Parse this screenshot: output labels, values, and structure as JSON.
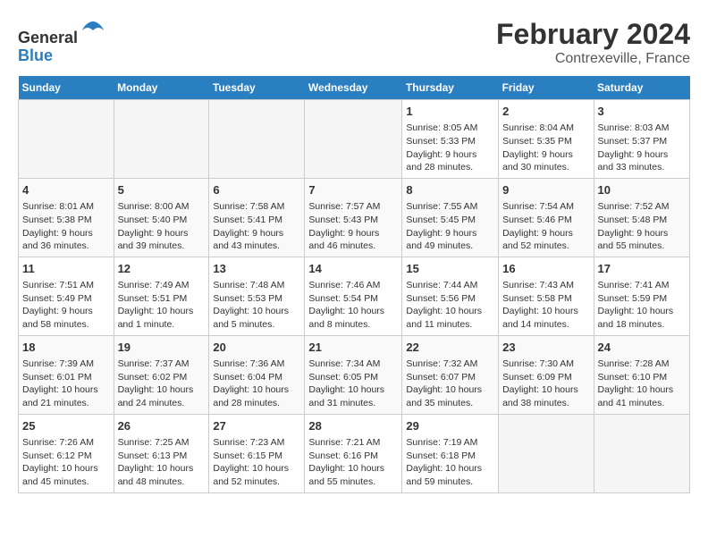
{
  "header": {
    "logo_line1": "General",
    "logo_line2": "Blue",
    "main_title": "February 2024",
    "subtitle": "Contrexeville, France"
  },
  "columns": [
    "Sunday",
    "Monday",
    "Tuesday",
    "Wednesday",
    "Thursday",
    "Friday",
    "Saturday"
  ],
  "weeks": [
    [
      {
        "day": "",
        "info": ""
      },
      {
        "day": "",
        "info": ""
      },
      {
        "day": "",
        "info": ""
      },
      {
        "day": "",
        "info": ""
      },
      {
        "day": "1",
        "info": "Sunrise: 8:05 AM\nSunset: 5:33 PM\nDaylight: 9 hours\nand 28 minutes."
      },
      {
        "day": "2",
        "info": "Sunrise: 8:04 AM\nSunset: 5:35 PM\nDaylight: 9 hours\nand 30 minutes."
      },
      {
        "day": "3",
        "info": "Sunrise: 8:03 AM\nSunset: 5:37 PM\nDaylight: 9 hours\nand 33 minutes."
      }
    ],
    [
      {
        "day": "4",
        "info": "Sunrise: 8:01 AM\nSunset: 5:38 PM\nDaylight: 9 hours\nand 36 minutes."
      },
      {
        "day": "5",
        "info": "Sunrise: 8:00 AM\nSunset: 5:40 PM\nDaylight: 9 hours\nand 39 minutes."
      },
      {
        "day": "6",
        "info": "Sunrise: 7:58 AM\nSunset: 5:41 PM\nDaylight: 9 hours\nand 43 minutes."
      },
      {
        "day": "7",
        "info": "Sunrise: 7:57 AM\nSunset: 5:43 PM\nDaylight: 9 hours\nand 46 minutes."
      },
      {
        "day": "8",
        "info": "Sunrise: 7:55 AM\nSunset: 5:45 PM\nDaylight: 9 hours\nand 49 minutes."
      },
      {
        "day": "9",
        "info": "Sunrise: 7:54 AM\nSunset: 5:46 PM\nDaylight: 9 hours\nand 52 minutes."
      },
      {
        "day": "10",
        "info": "Sunrise: 7:52 AM\nSunset: 5:48 PM\nDaylight: 9 hours\nand 55 minutes."
      }
    ],
    [
      {
        "day": "11",
        "info": "Sunrise: 7:51 AM\nSunset: 5:49 PM\nDaylight: 9 hours\nand 58 minutes."
      },
      {
        "day": "12",
        "info": "Sunrise: 7:49 AM\nSunset: 5:51 PM\nDaylight: 10 hours\nand 1 minute."
      },
      {
        "day": "13",
        "info": "Sunrise: 7:48 AM\nSunset: 5:53 PM\nDaylight: 10 hours\nand 5 minutes."
      },
      {
        "day": "14",
        "info": "Sunrise: 7:46 AM\nSunset: 5:54 PM\nDaylight: 10 hours\nand 8 minutes."
      },
      {
        "day": "15",
        "info": "Sunrise: 7:44 AM\nSunset: 5:56 PM\nDaylight: 10 hours\nand 11 minutes."
      },
      {
        "day": "16",
        "info": "Sunrise: 7:43 AM\nSunset: 5:58 PM\nDaylight: 10 hours\nand 14 minutes."
      },
      {
        "day": "17",
        "info": "Sunrise: 7:41 AM\nSunset: 5:59 PM\nDaylight: 10 hours\nand 18 minutes."
      }
    ],
    [
      {
        "day": "18",
        "info": "Sunrise: 7:39 AM\nSunset: 6:01 PM\nDaylight: 10 hours\nand 21 minutes."
      },
      {
        "day": "19",
        "info": "Sunrise: 7:37 AM\nSunset: 6:02 PM\nDaylight: 10 hours\nand 24 minutes."
      },
      {
        "day": "20",
        "info": "Sunrise: 7:36 AM\nSunset: 6:04 PM\nDaylight: 10 hours\nand 28 minutes."
      },
      {
        "day": "21",
        "info": "Sunrise: 7:34 AM\nSunset: 6:05 PM\nDaylight: 10 hours\nand 31 minutes."
      },
      {
        "day": "22",
        "info": "Sunrise: 7:32 AM\nSunset: 6:07 PM\nDaylight: 10 hours\nand 35 minutes."
      },
      {
        "day": "23",
        "info": "Sunrise: 7:30 AM\nSunset: 6:09 PM\nDaylight: 10 hours\nand 38 minutes."
      },
      {
        "day": "24",
        "info": "Sunrise: 7:28 AM\nSunset: 6:10 PM\nDaylight: 10 hours\nand 41 minutes."
      }
    ],
    [
      {
        "day": "25",
        "info": "Sunrise: 7:26 AM\nSunset: 6:12 PM\nDaylight: 10 hours\nand 45 minutes."
      },
      {
        "day": "26",
        "info": "Sunrise: 7:25 AM\nSunset: 6:13 PM\nDaylight: 10 hours\nand 48 minutes."
      },
      {
        "day": "27",
        "info": "Sunrise: 7:23 AM\nSunset: 6:15 PM\nDaylight: 10 hours\nand 52 minutes."
      },
      {
        "day": "28",
        "info": "Sunrise: 7:21 AM\nSunset: 6:16 PM\nDaylight: 10 hours\nand 55 minutes."
      },
      {
        "day": "29",
        "info": "Sunrise: 7:19 AM\nSunset: 6:18 PM\nDaylight: 10 hours\nand 59 minutes."
      },
      {
        "day": "",
        "info": ""
      },
      {
        "day": "",
        "info": ""
      }
    ]
  ]
}
